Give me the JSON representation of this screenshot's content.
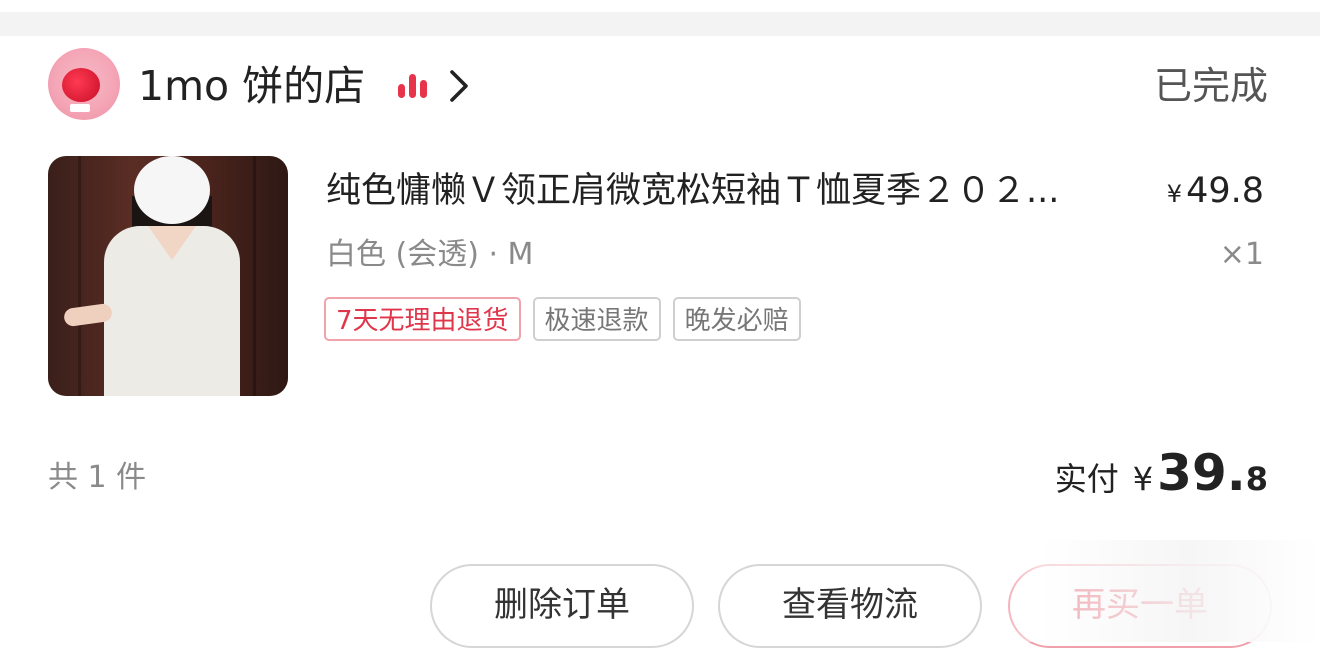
{
  "shop": {
    "name": "1mo 饼的店",
    "avatar_icon": "pink-mascot-avatar",
    "rank_icon": "bar-rank-icon",
    "rank_color": "#e8344a",
    "chevron_icon": "chevron-right-icon"
  },
  "order": {
    "status": "已完成"
  },
  "product": {
    "title": "纯色慵懒Ｖ领正肩微宽松短袖Ｔ恤夏季２０２...",
    "price_symbol": "¥",
    "price_value": "49.8",
    "variant": "白色 (会透) · M",
    "quantity": "×1",
    "tags": [
      {
        "label": "7天无理由退货",
        "style": "red"
      },
      {
        "label": "极速退款",
        "style": "gray"
      },
      {
        "label": "晚发必赔",
        "style": "gray"
      }
    ]
  },
  "summary": {
    "count_text": "共 1 件",
    "paid_label": "实付",
    "paid_symbol": "¥",
    "paid_int": "39.",
    "paid_dec": "8"
  },
  "actions": {
    "delete_label": "删除订单",
    "logistics_label": "查看物流",
    "rebuy_label": "再买一单"
  }
}
